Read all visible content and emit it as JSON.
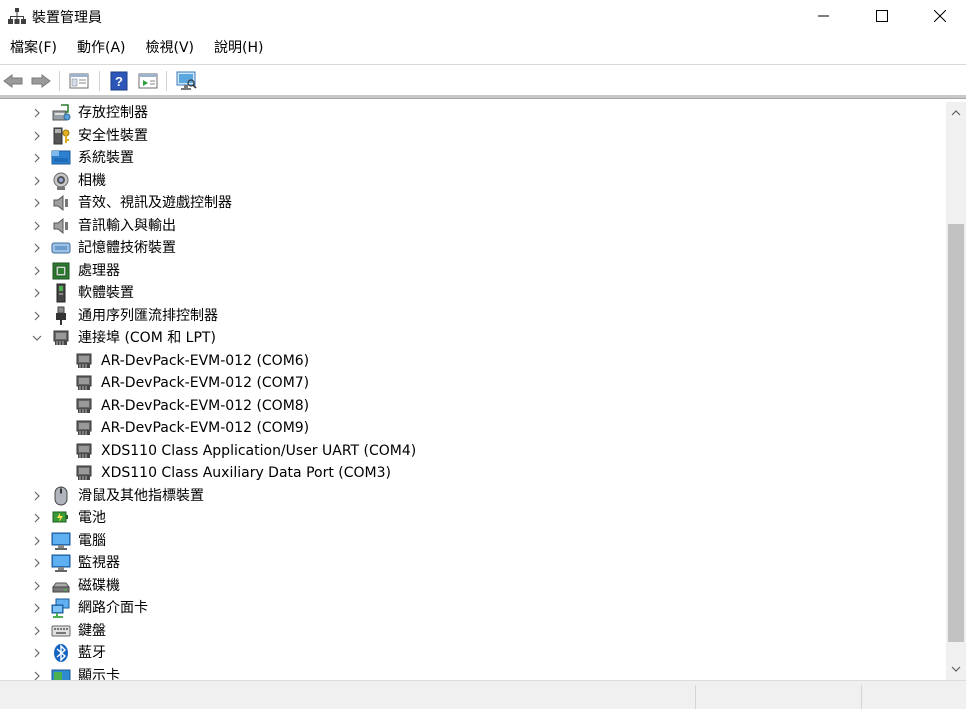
{
  "window": {
    "title": "裝置管理員",
    "colors": {
      "accent": "#1f5fbf",
      "tree_text": "#000000"
    }
  },
  "menu": [
    {
      "label": "檔案(F)"
    },
    {
      "label": "動作(A)"
    },
    {
      "label": "檢視(V)"
    },
    {
      "label": "說明(H)"
    }
  ],
  "toolbar": {
    "buttons": [
      "back-icon",
      "forward-icon",
      "show-hide-tree-icon",
      "help-icon",
      "properties-icon",
      "scan-hardware-icon"
    ]
  },
  "tree": {
    "items": [
      {
        "label": "存放控制器",
        "icon": "storage-controller-icon",
        "expanded": false
      },
      {
        "label": "安全性裝置",
        "icon": "security-device-icon",
        "expanded": false
      },
      {
        "label": "系統裝置",
        "icon": "system-device-icon",
        "expanded": false
      },
      {
        "label": "相機",
        "icon": "camera-icon",
        "expanded": false
      },
      {
        "label": "音效、視訊及遊戲控制器",
        "icon": "sound-icon",
        "expanded": false
      },
      {
        "label": "音訊輸入與輸出",
        "icon": "audio-io-icon",
        "expanded": false
      },
      {
        "label": "記憶體技術裝置",
        "icon": "memory-tech-icon",
        "expanded": false
      },
      {
        "label": "處理器",
        "icon": "processor-icon",
        "expanded": false
      },
      {
        "label": "軟體裝置",
        "icon": "software-device-icon",
        "expanded": false
      },
      {
        "label": "通用序列匯流排控制器",
        "icon": "usb-controller-icon",
        "expanded": false
      },
      {
        "label": "連接埠 (COM 和 LPT)",
        "icon": "port-icon",
        "expanded": true
      },
      {
        "label": "AR-DevPack-EVM-012 (COM6)",
        "icon": "port-device-icon",
        "child": true
      },
      {
        "label": "AR-DevPack-EVM-012 (COM7)",
        "icon": "port-device-icon",
        "child": true
      },
      {
        "label": "AR-DevPack-EVM-012 (COM8)",
        "icon": "port-device-icon",
        "child": true
      },
      {
        "label": "AR-DevPack-EVM-012 (COM9)",
        "icon": "port-device-icon",
        "child": true
      },
      {
        "label": "XDS110 Class Application/User UART (COM4)",
        "icon": "port-device-icon",
        "child": true
      },
      {
        "label": "XDS110 Class Auxiliary Data Port (COM3)",
        "icon": "port-device-icon",
        "child": true
      },
      {
        "label": "滑鼠及其他指標裝置",
        "icon": "mouse-icon",
        "expanded": false
      },
      {
        "label": "電池",
        "icon": "battery-icon",
        "expanded": false
      },
      {
        "label": "電腦",
        "icon": "computer-icon",
        "expanded": false
      },
      {
        "label": "監視器",
        "icon": "monitor-icon",
        "expanded": false
      },
      {
        "label": "磁碟機",
        "icon": "disk-drive-icon",
        "expanded": false
      },
      {
        "label": "網路介面卡",
        "icon": "network-adapter-icon",
        "expanded": false
      },
      {
        "label": "鍵盤",
        "icon": "keyboard-icon",
        "expanded": false
      },
      {
        "label": "藍牙",
        "icon": "bluetooth-icon",
        "expanded": false
      },
      {
        "label": "顯示卡",
        "icon": "display-adapter-icon",
        "expanded": false
      }
    ]
  },
  "scrollbar": {
    "position_fraction": 0.27
  }
}
